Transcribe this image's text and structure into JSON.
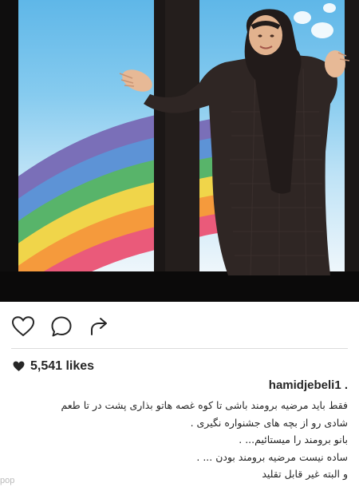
{
  "post": {
    "username": "hamidjebeli1 .",
    "likes_text": "5,541 likes",
    "caption_lines": [
      "فقط باید مرضیه برومند باشی تا کوه غصه هاتو بذاری پشت در تا طعم",
      "شادی رو از بچه های جشنواره نگیری .",
      "بانو برومند را میستائیم... .",
      "ساده نیست مرضیه برومند بودن ... .",
      "و البته غیر قابل تقلید"
    ]
  },
  "actions": {
    "like_icon": "heart-outline-icon",
    "comment_icon": "comment-bubble-icon",
    "share_icon": "share-arrow-icon"
  },
  "watermark": "pop"
}
